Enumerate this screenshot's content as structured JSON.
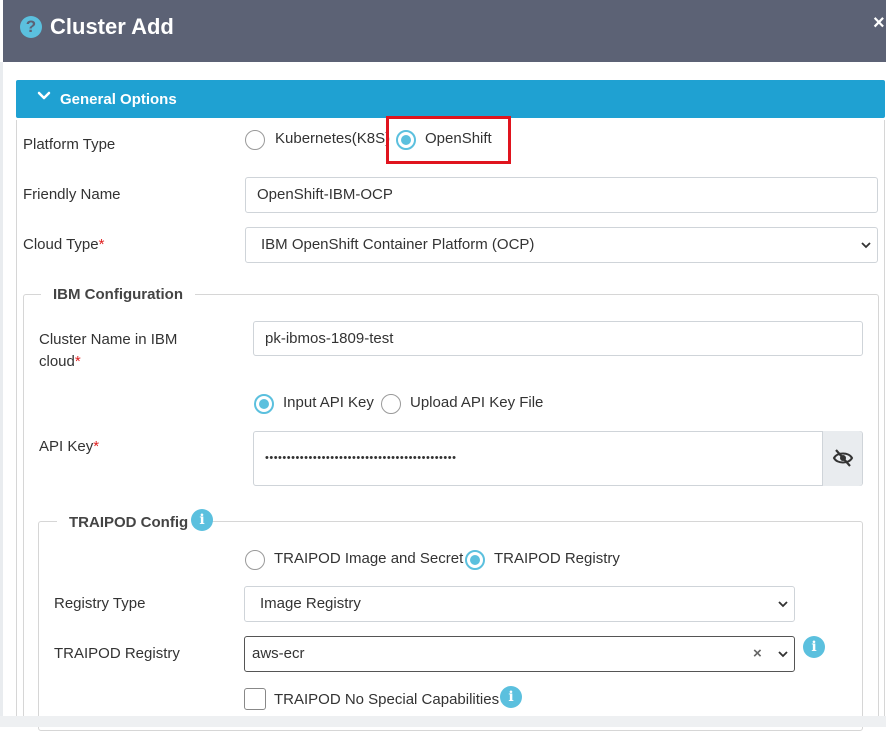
{
  "header": {
    "title": "Cluster Add",
    "close": "×",
    "help": "?"
  },
  "section": {
    "title": "General Options"
  },
  "platform": {
    "label": "Platform Type",
    "options": [
      "Kubernetes(K8S)",
      "OpenShift"
    ],
    "selected": "OpenShift"
  },
  "friendly_name": {
    "label": "Friendly Name",
    "value": "OpenShift-IBM-OCP"
  },
  "cloud_type": {
    "label": "Cloud Type",
    "required": "*",
    "value": "IBM OpenShift Container Platform (OCP)"
  },
  "ibm": {
    "legend": "IBM Configuration",
    "cluster_name": {
      "label": "Cluster Name in IBM cloud",
      "required": "*",
      "value": "pk-ibmos-1809-test"
    },
    "key_mode": {
      "options": [
        "Input API Key",
        "Upload API Key File"
      ],
      "selected": "Input API Key"
    },
    "api_key": {
      "label": "API Key",
      "required": "*",
      "value": "••••••••••••••••••••••••••••••••••••••••••••"
    }
  },
  "traipod": {
    "legend": "TRAIPOD Config",
    "mode": {
      "options": [
        "TRAIPOD Image and Secret",
        "TRAIPOD Registry"
      ],
      "selected": "TRAIPOD Registry"
    },
    "registry_type": {
      "label": "Registry Type",
      "value": "Image Registry"
    },
    "registry": {
      "label": "TRAIPOD Registry",
      "value": "aws-ecr",
      "clear": "×"
    },
    "no_special": {
      "label": "TRAIPOD No Special Capabilities",
      "checked": false
    }
  },
  "colors": {
    "header": "#5c6275",
    "section": "#1fa1d2",
    "accent": "#5bc0de",
    "highlight": "#e0141e",
    "required": "#e02020"
  }
}
